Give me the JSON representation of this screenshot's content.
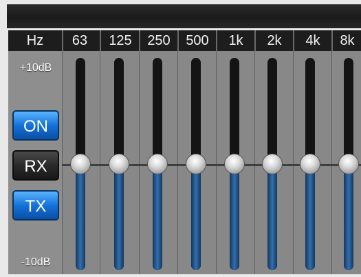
{
  "header": {
    "hz_label": "Hz",
    "bands": [
      "63",
      "125",
      "250",
      "500",
      "1k",
      "2k",
      "4k",
      "8k"
    ]
  },
  "range": {
    "max_label": "+10dB",
    "min_label": "-10dB",
    "max_db": 10,
    "min_db": -10
  },
  "buttons": [
    {
      "label": "ON",
      "state": "active"
    },
    {
      "label": "RX",
      "state": "inactive"
    },
    {
      "label": "TX",
      "state": "active"
    }
  ],
  "sliders": [
    {
      "band": "63",
      "gain_db": 0
    },
    {
      "band": "125",
      "gain_db": 0
    },
    {
      "band": "250",
      "gain_db": 0
    },
    {
      "band": "500",
      "gain_db": 0
    },
    {
      "band": "1k",
      "gain_db": 0
    },
    {
      "band": "2k",
      "gain_db": 0
    },
    {
      "band": "4k",
      "gain_db": 0
    },
    {
      "band": "8k",
      "gain_db": 0
    }
  ],
  "colors": {
    "active_button": "#1572d9",
    "inactive_button": "#2a2a2a",
    "fill": "#2f6fb0",
    "panel": "#888888"
  }
}
